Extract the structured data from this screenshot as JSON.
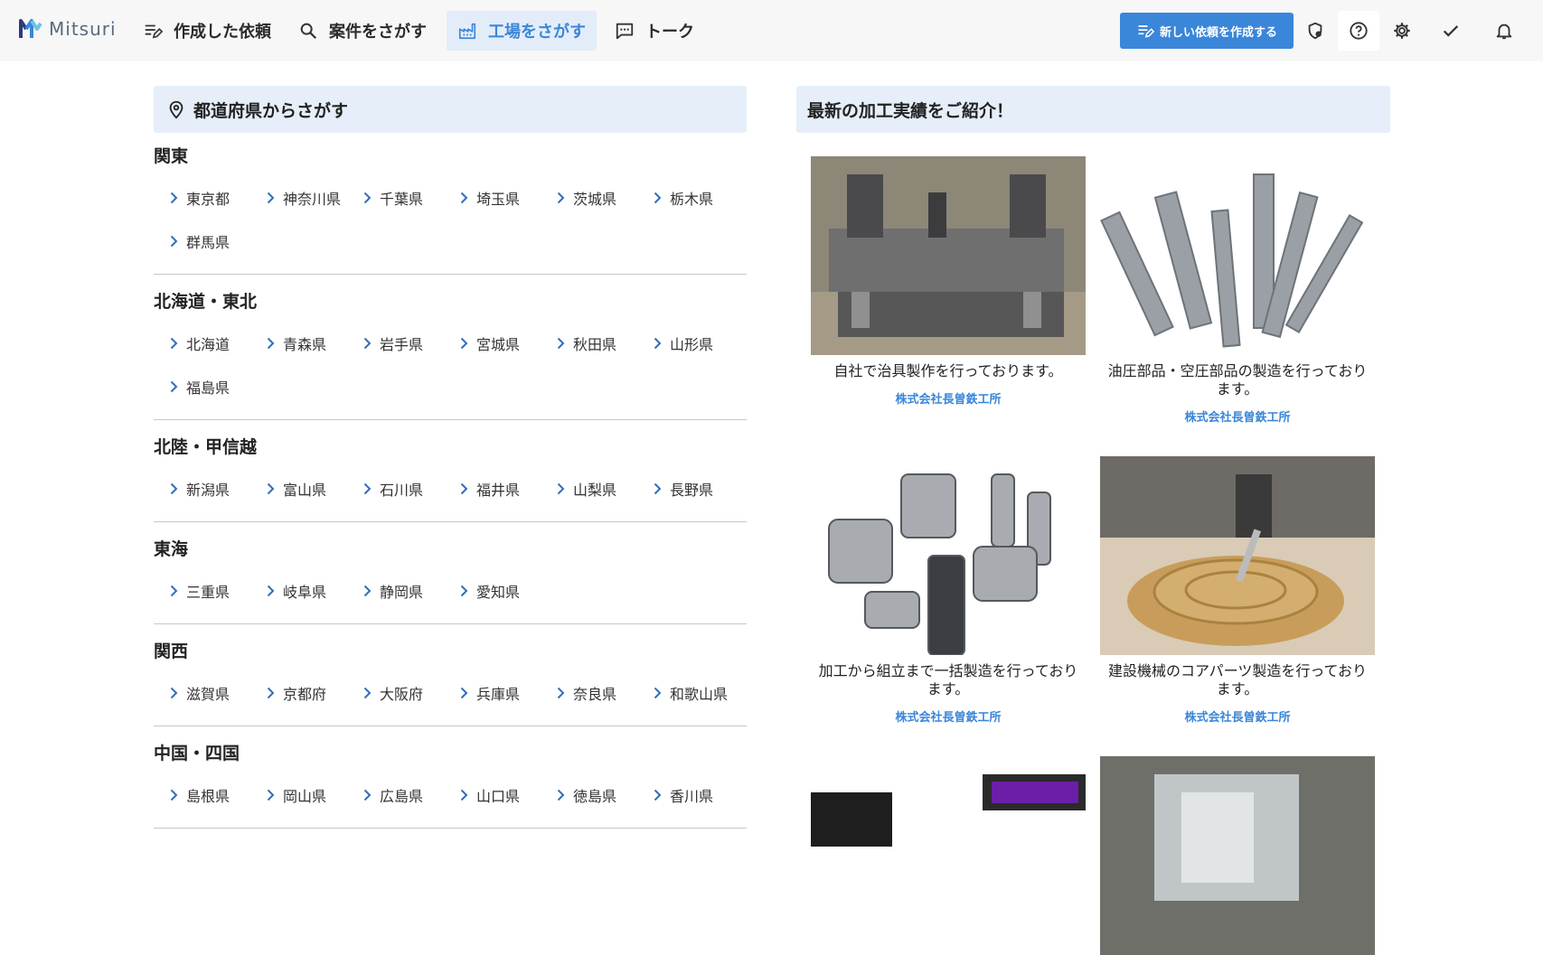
{
  "header": {
    "logo_text": "Mitsuri",
    "nav": [
      {
        "label": "作成した依頼",
        "icon": "edit-list-icon"
      },
      {
        "label": "案件をさがす",
        "icon": "search-icon"
      },
      {
        "label": "工場をさがす",
        "icon": "factory-icon",
        "active": true
      },
      {
        "label": "トーク",
        "icon": "chat-icon"
      }
    ],
    "new_request_label": "新しい依頼を作成する",
    "icons": [
      "shield-settings-icon",
      "help-icon",
      "gear-icon",
      "check-icon",
      "bell-icon"
    ],
    "accent_color": "#3a86d9"
  },
  "prefectures": {
    "title": "都道府県からさがす",
    "regions": [
      {
        "name": "関東",
        "items": [
          "東京都",
          "神奈川県",
          "千葉県",
          "埼玉県",
          "茨城県",
          "栃木県",
          "群馬県"
        ]
      },
      {
        "name": "北海道・東北",
        "items": [
          "北海道",
          "青森県",
          "岩手県",
          "宮城県",
          "秋田県",
          "山形県",
          "福島県"
        ]
      },
      {
        "name": "北陸・甲信越",
        "items": [
          "新潟県",
          "富山県",
          "石川県",
          "福井県",
          "山梨県",
          "長野県"
        ]
      },
      {
        "name": "東海",
        "items": [
          "三重県",
          "岐阜県",
          "静岡県",
          "愛知県"
        ]
      },
      {
        "name": "関西",
        "items": [
          "滋賀県",
          "京都府",
          "大阪府",
          "兵庫県",
          "奈良県",
          "和歌山県"
        ]
      },
      {
        "name": "中国・四国",
        "items": [
          "島根県",
          "岡山県",
          "広島県",
          "山口県",
          "徳島県",
          "香川県"
        ]
      }
    ]
  },
  "cases": {
    "title": "最新の加工実績をご紹介！",
    "cards": [
      {
        "desc": "自社で治具製作を行っております。",
        "company": "株式会社長曽鉄工所",
        "image": "jig-image"
      },
      {
        "desc": "油圧部品・空圧部品の製造を行っております。",
        "company": "株式会社長曽鉄工所",
        "image": "shafts-image"
      },
      {
        "desc": "加工から組立まで一括製造を行っております。",
        "company": "株式会社長曽鉄工所",
        "image": "hydraulic-parts-image"
      },
      {
        "desc": "建設機械のコアパーツ製造を行っております。",
        "company": "株式会社長曽鉄工所",
        "image": "brass-part-image"
      },
      {
        "desc": "",
        "company": "",
        "image": "electronics-image"
      },
      {
        "desc": "",
        "company": "",
        "image": "acrylic-image"
      }
    ]
  }
}
